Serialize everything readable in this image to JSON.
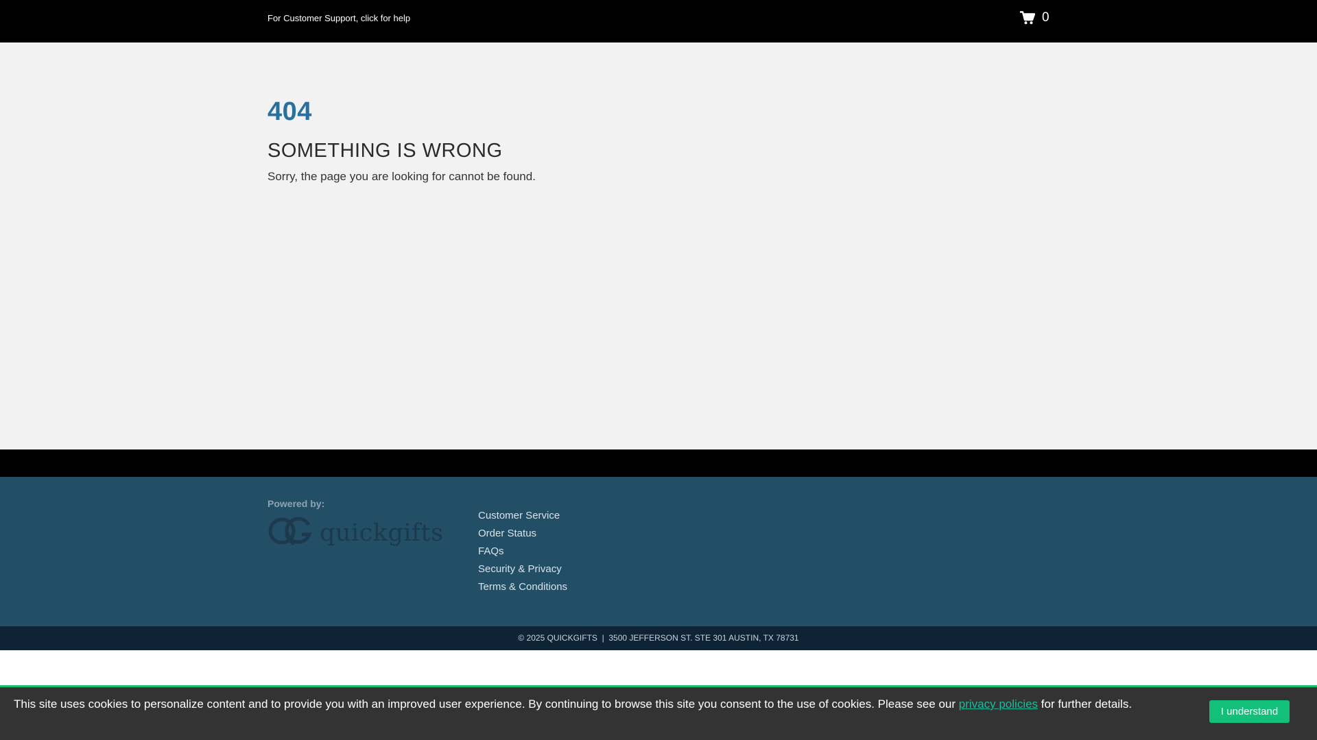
{
  "header": {
    "support_text": "For Customer Support, click for help",
    "cart_icon": "shopping-cart-icon",
    "cart_count": "0"
  },
  "error": {
    "code": "404",
    "title": "SOMETHING IS WRONG",
    "message": "Sorry, the page you are looking for cannot be found."
  },
  "footer": {
    "powered_by": "Powered by:",
    "logo_text": "quickgifts",
    "links": [
      "Customer Service",
      "Order Status",
      "FAQs",
      "Security & Privacy",
      "Terms & Conditions"
    ],
    "copyright": "© 2025 QUICKGIFTS  |  3500 JEFFERSON ST. STE 301 AUSTIN, TX 78731"
  },
  "cookie": {
    "text_before": "This site uses cookies to personalize content and to provide you with an improved user experience. By continuing to browse this site you consent to the use of cookies. Please see our ",
    "link_text": "privacy policies",
    "text_after": " for further details.",
    "button_label": "I understand"
  },
  "colors": {
    "accent_blue": "#2b6f9c",
    "footer_blue": "#224e66",
    "cookie_green": "#13c07a"
  }
}
